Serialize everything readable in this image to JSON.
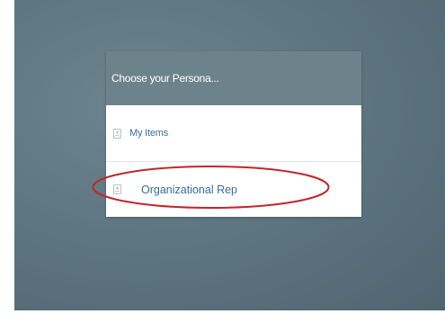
{
  "dialog": {
    "title": "Choose your Persona...",
    "items": [
      {
        "label": "My Items",
        "icon": "contact-card-icon"
      },
      {
        "label": "Organizational Rep",
        "icon": "contact-card-icon"
      }
    ]
  },
  "annotation": {
    "type": "ellipse",
    "color": "#c0262b",
    "target": "Organizational Rep"
  },
  "colors": {
    "header_bg": "#6d838c",
    "link_text": "#3a6e96",
    "backdrop": "#5e7681"
  }
}
